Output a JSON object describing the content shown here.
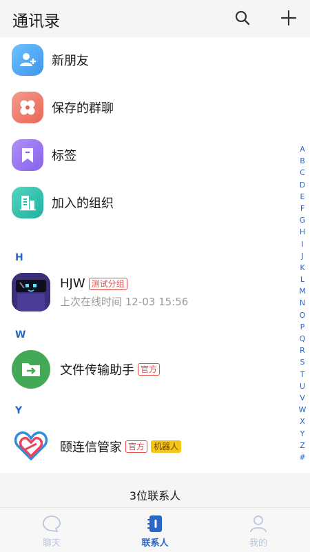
{
  "header": {
    "title": "通讯录",
    "search_icon": "search-icon",
    "add_icon": "plus-icon"
  },
  "menu": [
    {
      "label": "新朋友",
      "icon": "add-user-icon",
      "color": "#4aa8f5"
    },
    {
      "label": "保存的群聊",
      "icon": "group-chat-icon",
      "color": "#f07a6a"
    },
    {
      "label": "标签",
      "icon": "tag-icon",
      "color": "#9b7af2"
    },
    {
      "label": "加入的组织",
      "icon": "organization-icon",
      "color": "#31c4b0"
    }
  ],
  "sections": [
    {
      "letter": "H",
      "contacts": [
        {
          "name": "HJW",
          "tags": [
            "测试分组"
          ],
          "status": "上次在线时间 12-03 15:56"
        }
      ]
    },
    {
      "letter": "W",
      "contacts": [
        {
          "name": "文件传输助手",
          "tags": [
            "官方"
          ],
          "status": ""
        }
      ]
    },
    {
      "letter": "Y",
      "contacts": [
        {
          "name": "颐连信管家",
          "tags": [
            "官方",
            "机器人"
          ],
          "status": ""
        }
      ]
    }
  ],
  "alphabet": [
    "A",
    "B",
    "C",
    "D",
    "E",
    "F",
    "G",
    "H",
    "I",
    "J",
    "K",
    "L",
    "M",
    "N",
    "O",
    "P",
    "Q",
    "R",
    "S",
    "T",
    "U",
    "V",
    "W",
    "X",
    "Y",
    "Z",
    "#"
  ],
  "contact_count": "3位联系人",
  "tabs": [
    {
      "label": "聊天",
      "icon": "chat-bubble-icon",
      "active": false
    },
    {
      "label": "联系人",
      "icon": "contacts-book-icon",
      "active": true
    },
    {
      "label": "我的",
      "icon": "profile-icon",
      "active": false
    }
  ],
  "colors": {
    "accent": "#2a66c8",
    "tag_red": "#e04b4b",
    "robot_yellow": "#f5c518"
  }
}
